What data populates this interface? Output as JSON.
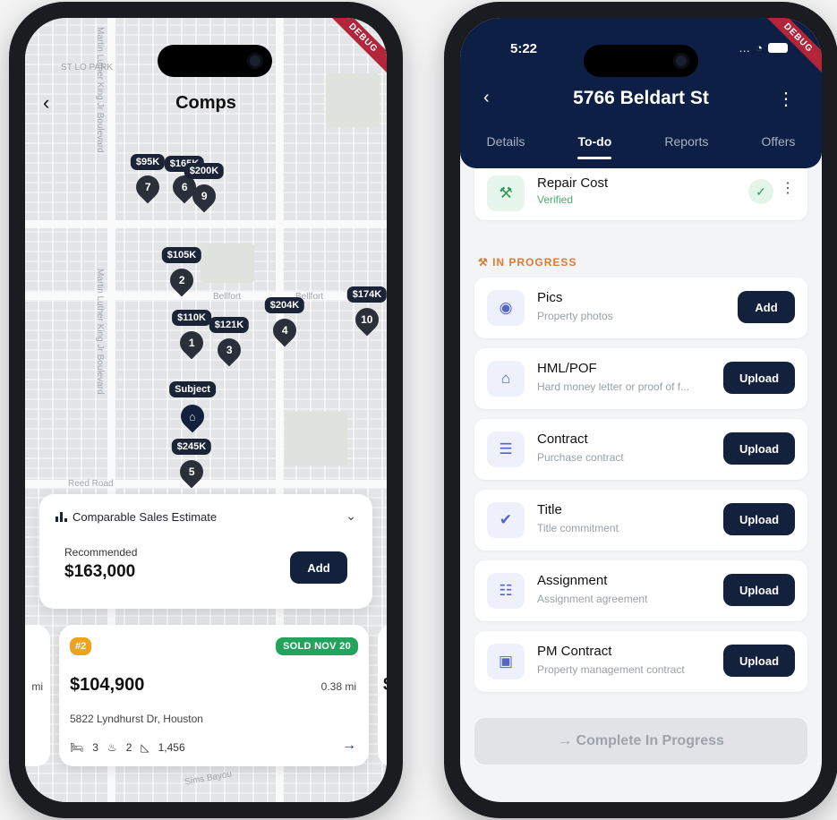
{
  "left": {
    "title": "Comps",
    "debug": "DEBUG",
    "map_labels": [
      "ST LO PARK",
      "Martin Luther King Jr Boulevard",
      "Bellfort",
      "Reed Road",
      "Sims Bayou",
      "Martin Luther King Jr Boulevard",
      "Martin Luther King Jr Boulevard"
    ],
    "pins": [
      {
        "price": "$95K",
        "num": "7"
      },
      {
        "price": "$165K",
        "num": "6"
      },
      {
        "price": "$200K",
        "num": "9"
      },
      {
        "price": "$105K",
        "num": "2"
      },
      {
        "price": "$110K",
        "num": "1"
      },
      {
        "price": "$121K",
        "num": "3"
      },
      {
        "price": "$204K",
        "num": "4"
      },
      {
        "price": "$174K",
        "num": "10"
      },
      {
        "price": "$245K",
        "num": "5"
      }
    ],
    "subject_label": "Subject",
    "estimate": {
      "heading": "Comparable Sales Estimate",
      "recommended_label": "Recommended",
      "value": "$163,000",
      "add_label": "Add"
    },
    "comp_card": {
      "rank": "#2",
      "sold": "SOLD NOV 20",
      "price": "$104,900",
      "distance": "0.38 mi",
      "address": "5822 Lyndhurst Dr, Houston",
      "beds": "3",
      "baths": "2",
      "sqft": "1,456"
    },
    "peek_left_text": "mi",
    "peek_right_text": "$"
  },
  "right": {
    "time": "5:22",
    "debug": "DEBUG",
    "title": "5766 Beldart St",
    "tabs": [
      "Details",
      "To-do",
      "Reports",
      "Offers"
    ],
    "active_tab": "To-do",
    "repair": {
      "name": "Repair Cost",
      "status": "Verified"
    },
    "section_label": "IN PROGRESS",
    "tasks": [
      {
        "name": "Pics",
        "sub": "Property photos",
        "btn": "Add",
        "icon": "camera-icon"
      },
      {
        "name": "HML/POF",
        "sub": "Hard money letter or proof of f...",
        "btn": "Upload",
        "icon": "bank-icon"
      },
      {
        "name": "Contract",
        "sub": "Purchase contract",
        "btn": "Upload",
        "icon": "document-icon"
      },
      {
        "name": "Title",
        "sub": "Title commitment",
        "btn": "Upload",
        "icon": "verified-badge-icon"
      },
      {
        "name": "Assignment",
        "sub": "Assignment agreement",
        "btn": "Upload",
        "icon": "clipboard-icon"
      },
      {
        "name": "PM Contract",
        "sub": "Property management contract",
        "btn": "Upload",
        "icon": "briefcase-icon"
      }
    ],
    "complete_label": "→  Complete In Progress"
  },
  "colors": {
    "navy": "#0d1f44",
    "button": "#13213d",
    "sold_green": "#22a45d",
    "rank_orange": "#f0a21a",
    "section_orange": "#e07a32"
  }
}
